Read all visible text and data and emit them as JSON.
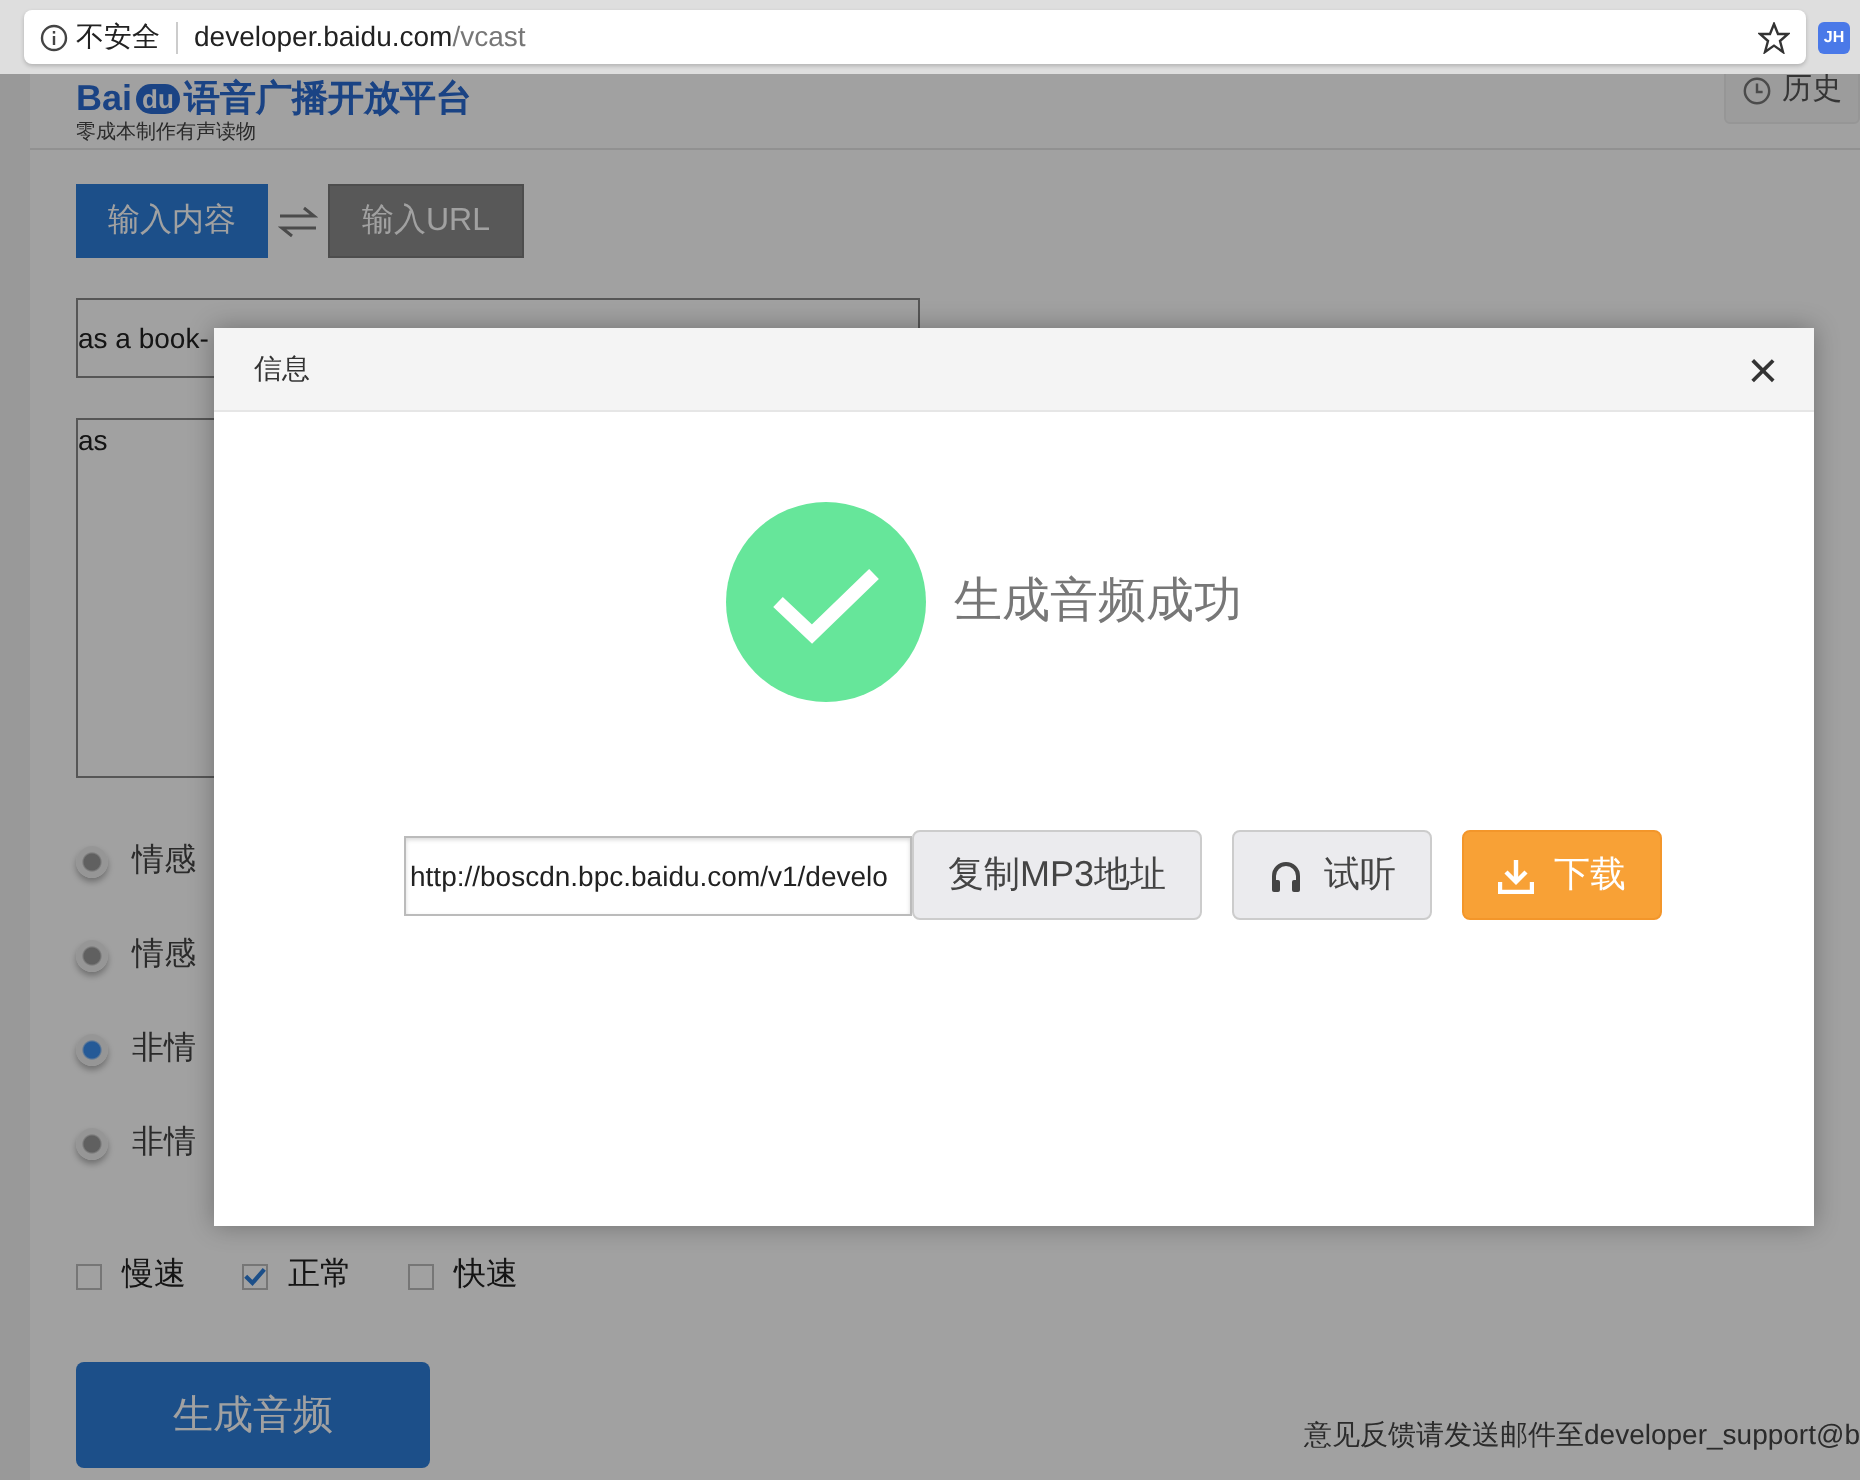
{
  "browser": {
    "security_label": "不安全",
    "url_host": "developer.baidu.com",
    "url_path": "/vcast",
    "extension_badge": "JH"
  },
  "header": {
    "logo_left": "Bai",
    "logo_mark": "du",
    "logo_title": "语音广播开放平台",
    "slogan": "零成本制作有声读物",
    "history_button": "历史"
  },
  "input_tabs": [
    {
      "label": "输入内容",
      "selected": true
    },
    {
      "label": "输入URL",
      "selected": false
    }
  ],
  "title_field": {
    "value": "as a book-"
  },
  "content_field": {
    "value": "as"
  },
  "voices": [
    {
      "label": "情感",
      "selected": false
    },
    {
      "label": "情感",
      "selected": false
    },
    {
      "label": "非情",
      "selected": true
    },
    {
      "label": "非情",
      "selected": false
    }
  ],
  "speeds": [
    {
      "label": "慢速",
      "checked": false
    },
    {
      "label": "正常",
      "checked": true
    },
    {
      "label": "快速",
      "checked": false
    }
  ],
  "generate_button": "生成音频",
  "footer": "意见反馈请发送邮件至developer_support@b",
  "dialog": {
    "title": "信息",
    "close": "×",
    "message": "生成音频成功",
    "url_value": "http://boscdn.bpc.baidu.com/v1/develo",
    "buttons": [
      {
        "kind": "copy",
        "label": "复制MP3地址"
      },
      {
        "kind": "listen",
        "label": "试听"
      },
      {
        "kind": "download",
        "label": "下载"
      }
    ]
  }
}
